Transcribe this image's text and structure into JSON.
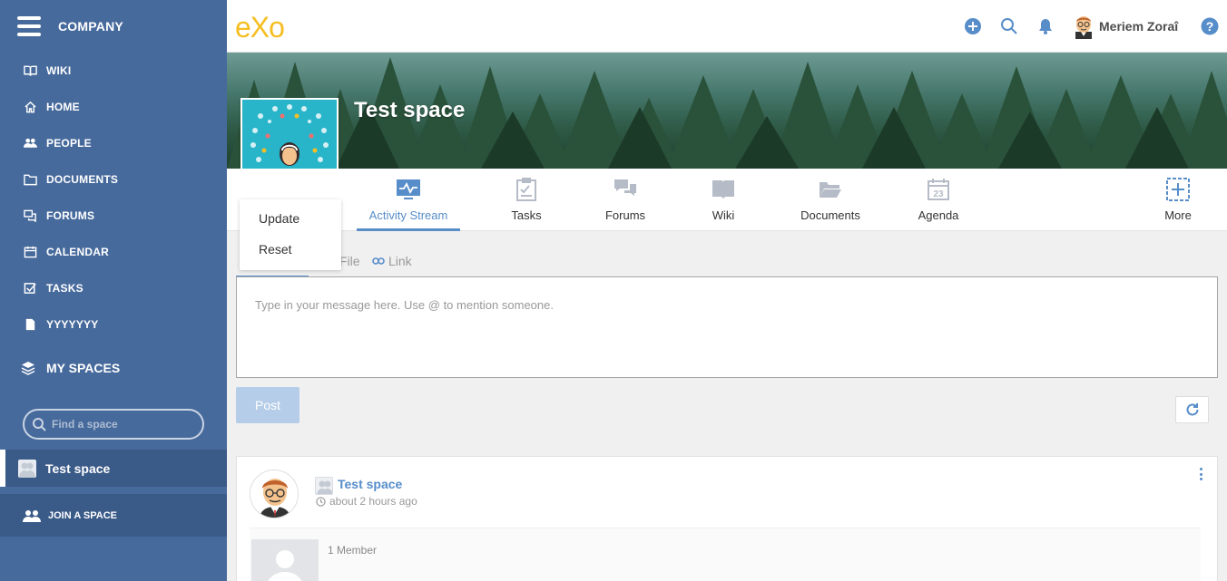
{
  "sidebar": {
    "company": "COMPANY",
    "items": [
      {
        "label": "WIKI"
      },
      {
        "label": "HOME"
      },
      {
        "label": "PEOPLE"
      },
      {
        "label": "DOCUMENTS"
      },
      {
        "label": "FORUMS"
      },
      {
        "label": "CALENDAR"
      },
      {
        "label": "TASKS"
      },
      {
        "label": "YYYYYYY"
      }
    ],
    "my_spaces": "MY SPACES",
    "find_space_placeholder": "Find a space",
    "active_space": "Test space",
    "join_space": "JOIN A SPACE"
  },
  "topbar": {
    "logo": "eXo",
    "user_name": "Meriem Zoraî"
  },
  "space": {
    "title": "Test space"
  },
  "tabs": [
    {
      "label": "Activity Stream"
    },
    {
      "label": "Tasks"
    },
    {
      "label": "Forums"
    },
    {
      "label": "Wiki"
    },
    {
      "label": "Documents"
    },
    {
      "label": "Agenda"
    },
    {
      "label": "More"
    }
  ],
  "avatar_menu": {
    "update": "Update",
    "reset": "Reset"
  },
  "composer": {
    "tab_file": "File",
    "tab_link": "Link",
    "placeholder": "Type in your message here. Use @ to mention someone.",
    "post_label": "Post"
  },
  "activity": {
    "space_name": "Test space",
    "time": "about 2 hours ago",
    "member_count": "1 Member"
  },
  "colors": {
    "sidebar": "#476a9c",
    "accent": "#578dc9",
    "logo": "#f5be23"
  }
}
